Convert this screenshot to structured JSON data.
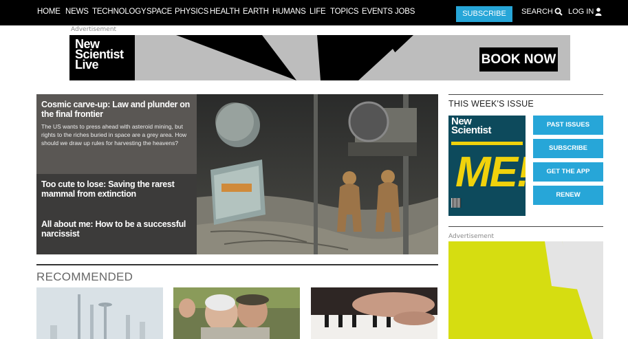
{
  "nav": {
    "items": [
      "HOME",
      "NEWS",
      "TECHNOLOGY",
      "SPACE",
      "PHYSICS",
      "HEALTH",
      "EARTH",
      "HUMANS",
      "LIFE",
      "TOPICS",
      "EVENTS",
      "JOBS"
    ],
    "subscribe": "SUBSCRIBE",
    "search": "SEARCH",
    "search_icon": "search-icon",
    "login": "LOG IN",
    "login_icon": "user-icon"
  },
  "banner_ad": {
    "label": "Advertisement",
    "brand_lines": [
      "New",
      "Scientist",
      "Live"
    ],
    "cta": "BOOK NOW"
  },
  "hero": {
    "main": {
      "title": "Cosmic carve-up: Law and plunder on the final frontier",
      "summary": "The US wants to press ahead with asteroid mining, but rights to the riches buried in space are a grey area. How should we draw up rules for harvesting the heavens?"
    },
    "secondary": [
      {
        "title": "Too cute to lose: Saving the rarest mammal from extinction"
      },
      {
        "title": "All about me: How to be a successful narcissist"
      }
    ]
  },
  "recommended": {
    "title": "RECOMMENDED"
  },
  "sidebar": {
    "issue_title": "THIS WEEK'S ISSUE",
    "cover": {
      "logo_lines": [
        "New",
        "Scientist"
      ],
      "headline": "ME!"
    },
    "buttons": [
      "PAST ISSUES",
      "SUBSCRIBE",
      "GET THE APP",
      "RENEW"
    ],
    "ad_label": "Advertisement"
  },
  "colors": {
    "nav_bg": "#000000",
    "accent_blue": "#27a6d8",
    "ad_yellow": "#d6dd11",
    "cover_teal": "#0d4a5c"
  }
}
